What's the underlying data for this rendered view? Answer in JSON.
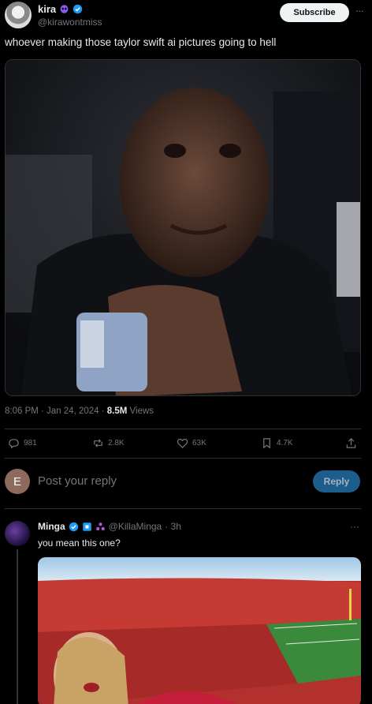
{
  "post": {
    "author_name": "kira",
    "author_handle": "@kirawontmiss",
    "subscribe_label": "Subscribe",
    "more_label": "···",
    "text": "whoever making those taylor swift ai pictures going to hell",
    "time": "8:06 PM · Jan 24, 2024 · ",
    "views_count": "8.5M",
    "views_label": " Views"
  },
  "actions": {
    "replies": "981",
    "reposts": "2.8K",
    "likes": "63K",
    "bookmarks": "4.7K"
  },
  "composer": {
    "avatar_letter": "E",
    "placeholder": "Post your reply",
    "reply_label": "Reply"
  },
  "reply": {
    "author_name": "Minga",
    "author_handle": "@KillaMinga",
    "time": "· 3h",
    "more_label": "···",
    "text": "you mean this one?"
  },
  "colors": {
    "background": "#000000",
    "text_primary": "#e7e9ea",
    "text_secondary": "#71767b",
    "verified": "#1d9bf0",
    "reply_button": "#1d5d8e"
  }
}
